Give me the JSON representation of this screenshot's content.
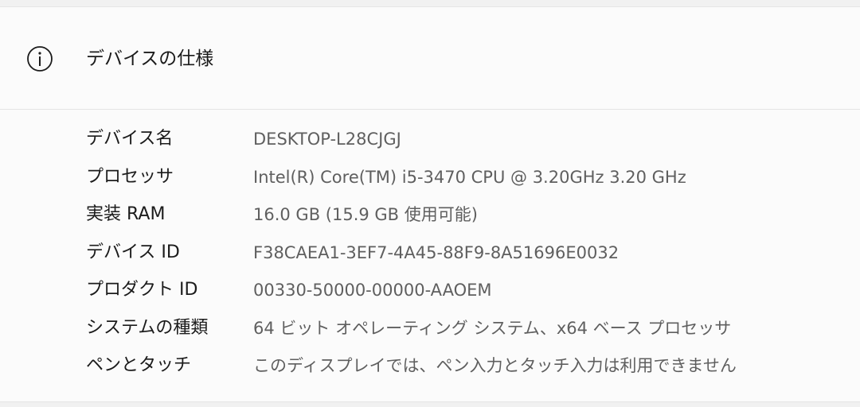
{
  "section": {
    "title": "デバイスの仕様",
    "icon": "info-icon"
  },
  "specs": [
    {
      "label": "デバイス名",
      "value": "DESKTOP-L28CJGJ"
    },
    {
      "label": "プロセッサ",
      "value": "Intel(R) Core(TM) i5-3470 CPU @ 3.20GHz   3.20 GHz"
    },
    {
      "label": "実装 RAM",
      "value": "16.0 GB (15.9 GB 使用可能)"
    },
    {
      "label": "デバイス ID",
      "value": "F38CAEA1-3EF7-4A45-88F9-8A51696E0032"
    },
    {
      "label": "プロダクト ID",
      "value": "00330-50000-00000-AAOEM"
    },
    {
      "label": "システムの種類",
      "value": "64 ビット オペレーティング システム、x64 ベース プロセッサ"
    },
    {
      "label": "ペンとタッチ",
      "value": "このディスプレイでは、ペン入力とタッチ入力は利用できません"
    }
  ]
}
